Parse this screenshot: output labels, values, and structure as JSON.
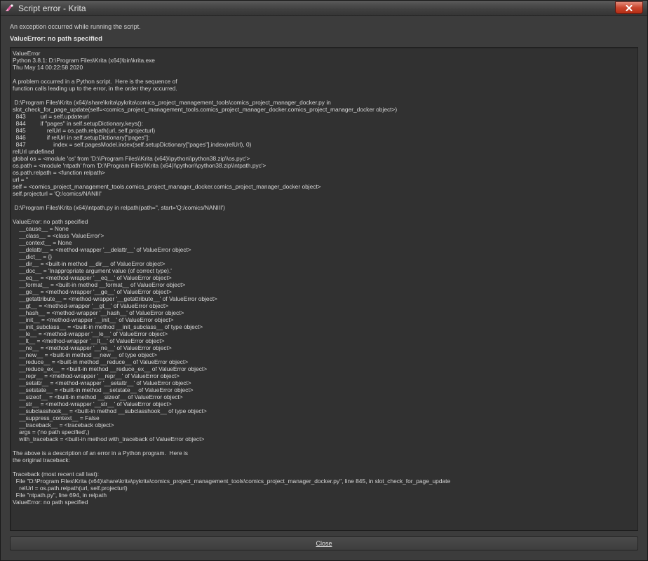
{
  "window": {
    "title": "Script error - Krita",
    "close_glyph": "✕"
  },
  "message": {
    "text": "An exception occurred while running the script.",
    "error": "ValueError: no path specified"
  },
  "details": {
    "lines": [
      "ValueError",
      "Python 3.8.1: D:\\Program Files\\Krita (x64)\\bin\\krita.exe",
      "Thu May 14 00:22:58 2020",
      "",
      "A problem occurred in a Python script.  Here is the sequence of",
      "function calls leading up to the error, in the order they occurred.",
      "",
      " D:\\Program Files\\Krita (x64)\\share\\krita\\pykrita\\comics_project_management_tools\\comics_project_manager_docker.py in",
      "slot_check_for_page_update(self=<comics_project_management_tools.comics_project_manager_docker.comics_project_manager_docker object>)",
      "  843         url = self.updateurl",
      "  844         if \"pages\" in self.setupDictionary.keys():",
      "  845             relUrl = os.path.relpath(url, self.projecturl)",
      "  846             if relUrl in self.setupDictionary[\"pages\"]:",
      "  847                 index = self.pagesModel.index(self.setupDictionary[\"pages\"].index(relUrl), 0)",
      "relUrl undefined",
      "global os = <module 'os' from 'D:\\\\Program Files\\\\Krita (x64)\\\\python\\\\python38.zip\\\\os.pyc'>",
      "os.path = <module 'ntpath' from 'D:\\\\Program Files\\\\Krita (x64)\\\\python\\\\python38.zip\\\\ntpath.pyc'>",
      "os.path.relpath = <function relpath>",
      "url = ''",
      "self = <comics_project_management_tools.comics_project_manager_docker.comics_project_manager_docker object>",
      "self.projecturl = 'Q:/comics/NANIII'",
      "",
      " D:\\Program Files\\Krita (x64)\\ntpath.py in relpath(path='', start='Q:/comics/NANIII')",
      "",
      "ValueError: no path specified",
      "    __cause__ = None",
      "    __class__ = <class 'ValueError'>",
      "    __context__ = None",
      "    __delattr__ = <method-wrapper '__delattr__' of ValueError object>",
      "    __dict__ = {}",
      "    __dir__ = <built-in method __dir__ of ValueError object>",
      "    __doc__ = 'Inappropriate argument value (of correct type).'",
      "    __eq__ = <method-wrapper '__eq__' of ValueError object>",
      "    __format__ = <built-in method __format__ of ValueError object>",
      "    __ge__ = <method-wrapper '__ge__' of ValueError object>",
      "    __getattribute__ = <method-wrapper '__getattribute__' of ValueError object>",
      "    __gt__ = <method-wrapper '__gt__' of ValueError object>",
      "    __hash__ = <method-wrapper '__hash__' of ValueError object>",
      "    __init__ = <method-wrapper '__init__' of ValueError object>",
      "    __init_subclass__ = <built-in method __init_subclass__ of type object>",
      "    __le__ = <method-wrapper '__le__' of ValueError object>",
      "    __lt__ = <method-wrapper '__lt__' of ValueError object>",
      "    __ne__ = <method-wrapper '__ne__' of ValueError object>",
      "    __new__ = <built-in method __new__ of type object>",
      "    __reduce__ = <built-in method __reduce__ of ValueError object>",
      "    __reduce_ex__ = <built-in method __reduce_ex__ of ValueError object>",
      "    __repr__ = <method-wrapper '__repr__' of ValueError object>",
      "    __setattr__ = <method-wrapper '__setattr__' of ValueError object>",
      "    __setstate__ = <built-in method __setstate__ of ValueError object>",
      "    __sizeof__ = <built-in method __sizeof__ of ValueError object>",
      "    __str__ = <method-wrapper '__str__' of ValueError object>",
      "    __subclasshook__ = <built-in method __subclasshook__ of type object>",
      "    __suppress_context__ = False",
      "    __traceback__ = <traceback object>",
      "    args = ('no path specified',)",
      "    with_traceback = <built-in method with_traceback of ValueError object>",
      "",
      "The above is a description of an error in a Python program.  Here is",
      "the original traceback:",
      "",
      "Traceback (most recent call last):",
      "  File \"D:\\Program Files\\Krita (x64)\\share\\krita\\pykrita\\comics_project_management_tools\\comics_project_manager_docker.py\", line 845, in slot_check_for_page_update",
      "    relUrl = os.path.relpath(url, self.projecturl)",
      "  File \"ntpath.py\", line 694, in relpath",
      "ValueError: no path specified"
    ]
  },
  "buttons": {
    "close_label": "Close"
  }
}
